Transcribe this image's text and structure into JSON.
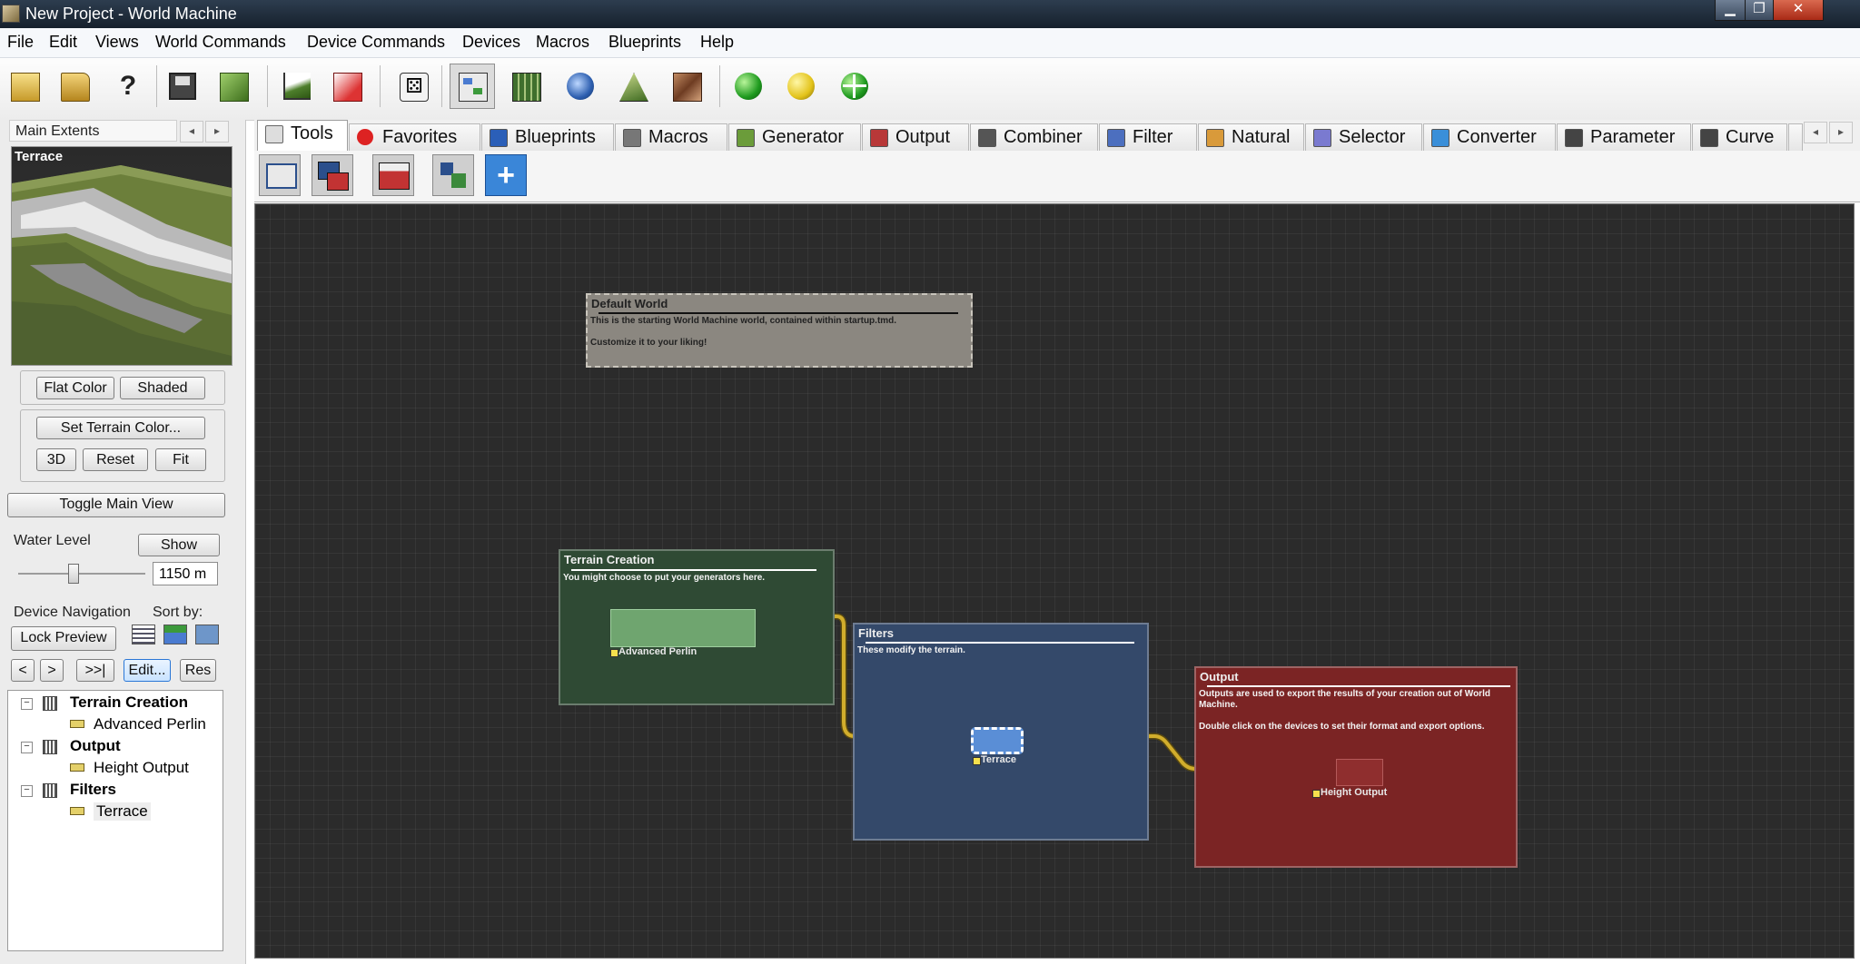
{
  "window": {
    "title": "New Project - World Machine",
    "controls": {
      "minimize": "▁",
      "maximize": "❐",
      "close": "✕"
    }
  },
  "menu": [
    "File",
    "Edit",
    "Views",
    "World Commands",
    "Device Commands",
    "Devices",
    "Macros",
    "Blueprints",
    "Help"
  ],
  "toolbar": {
    "icons": [
      "new-project-icon",
      "open-project-icon",
      "help-icon",
      "save-icon",
      "export-icon",
      "terrain-view-icon",
      "build-icon",
      "random-seed-icon",
      "device-view-icon",
      "layout-view-icon",
      "world-view-icon",
      "explorer-view-icon",
      "texture-view-icon",
      "build-go-icon",
      "build-pause-icon",
      "build-extents-icon"
    ],
    "active": "device-view-icon"
  },
  "left_panel": {
    "extents_select": "Main Extents",
    "preview_label": "Terrain",
    "preview_overlay": "Terrace",
    "buttons": {
      "flat_color": "Flat Color",
      "shaded": "Shaded",
      "set_terrain_color": "Set Terrain Color...",
      "three_d": "3D",
      "reset": "Reset",
      "fit": "Fit",
      "toggle_main_view": "Toggle Main View",
      "water_show": "Show",
      "lock_preview": "Lock Preview",
      "nav_prev": "<",
      "nav_next": ">",
      "nav_last": ">>|",
      "edit": "Edit...",
      "res": "Res"
    },
    "water_level_label": "Water Level",
    "water_level_value": "1150 m",
    "water_level_fraction": 0.43,
    "device_navigation_label": "Device Navigation",
    "sort_by_label": "Sort by:",
    "tree": [
      {
        "label": "Terrain Creation",
        "type": "group"
      },
      {
        "label": "Advanced Perlin",
        "type": "device"
      },
      {
        "label": "Output",
        "type": "group"
      },
      {
        "label": "Height Output",
        "type": "device"
      },
      {
        "label": "Filters",
        "type": "group"
      },
      {
        "label": "Terrace",
        "type": "device",
        "selected": true
      }
    ]
  },
  "tabs": [
    {
      "label": "Tools",
      "icon": "tools-icon",
      "active": true
    },
    {
      "label": "Favorites",
      "icon": "heart-icon"
    },
    {
      "label": "Blueprints",
      "icon": "blueprints-icon"
    },
    {
      "label": "Macros",
      "icon": "macros-icon"
    },
    {
      "label": "Generator",
      "icon": "generator-icon"
    },
    {
      "label": "Output",
      "icon": "output-icon"
    },
    {
      "label": "Combiner",
      "icon": "combiner-icon"
    },
    {
      "label": "Filter",
      "icon": "filter-icon"
    },
    {
      "label": "Natural",
      "icon": "natural-icon"
    },
    {
      "label": "Selector",
      "icon": "selector-icon"
    },
    {
      "label": "Converter",
      "icon": "converter-icon"
    },
    {
      "label": "Parameter",
      "icon": "parameter-icon"
    },
    {
      "label": "Curve",
      "icon": "curve-icon"
    }
  ],
  "tab_scroll": {
    "left": "◂",
    "right": "▸"
  },
  "subtools": [
    "group-tool-icon",
    "group-color-tool-icon",
    "device-color-tool-icon",
    "layout-tool-icon",
    "add-tool-icon"
  ],
  "canvas": {
    "default_world": {
      "title": "Default World",
      "desc": "This is the starting World Machine world, contained within startup.tmd.\n\nCustomize it to your liking!"
    },
    "terrain_creation": {
      "title": "Terrain Creation",
      "desc": "You might choose to put your generators here.",
      "device": "Advanced Perlin"
    },
    "filters": {
      "title": "Filters",
      "desc": "These modify the terrain.",
      "device": "Terrace"
    },
    "output": {
      "title": "Output",
      "desc": "Outputs are used to export the results of your creation out of World Machine.\n\nDouble click on the devices to set their format and export options.",
      "device": "Height Output"
    }
  },
  "colors": {
    "terrain_group": "#2f4a34",
    "filters_group": "#34496a",
    "output_group": "#7b2424",
    "default_world_group": "#8b8780",
    "wire": "#c8a627",
    "canvas": "#2b2b2b"
  }
}
